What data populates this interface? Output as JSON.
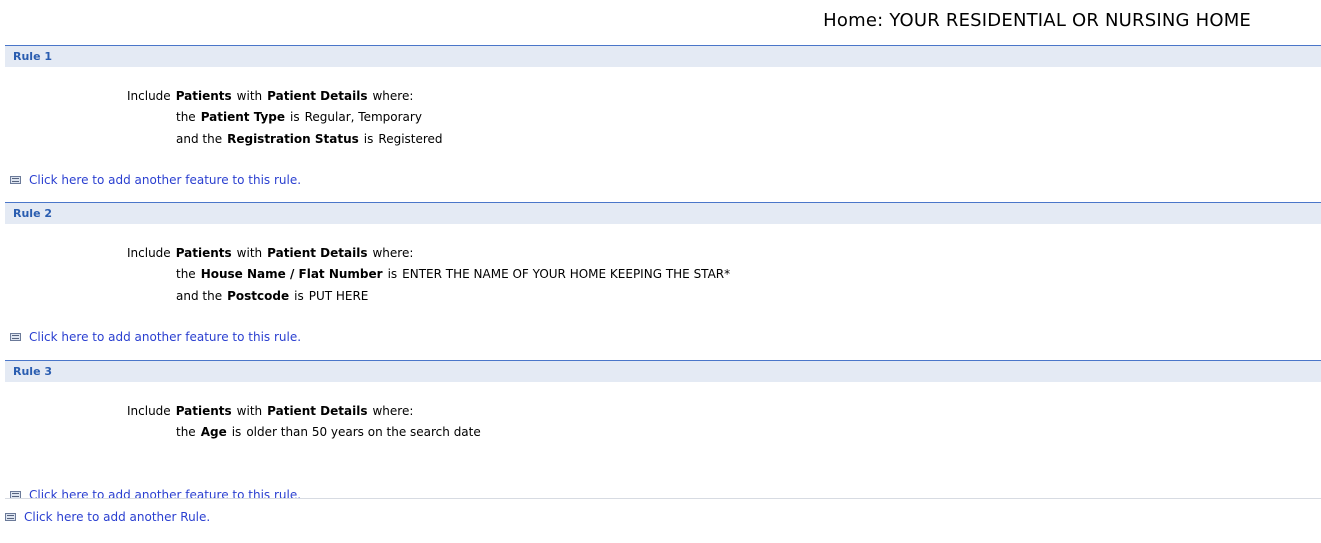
{
  "page": {
    "title": "Home: YOUR RESIDENTIAL OR NURSING HOME"
  },
  "rules": [
    {
      "title": "Rule 1",
      "include": "Include",
      "entity": "Patients",
      "with": "with",
      "details": "Patient Details",
      "where": "where:",
      "conditions": [
        {
          "prefix": "the",
          "field": "Patient Type",
          "op": "is",
          "value": "Regular, Temporary"
        },
        {
          "prefix": "and the",
          "field": "Registration Status",
          "op": "is",
          "value": "Registered"
        }
      ],
      "add_feature_label": "Click here to add another feature to this rule."
    },
    {
      "title": "Rule 2",
      "include": "Include",
      "entity": "Patients",
      "with": "with",
      "details": "Patient Details",
      "where": "where:",
      "conditions": [
        {
          "prefix": "the",
          "field": "House Name / Flat Number",
          "op": "is",
          "value": "ENTER THE NAME OF YOUR HOME KEEPING THE STAR*"
        },
        {
          "prefix": "and the",
          "field": "Postcode",
          "op": "is",
          "value": "PUT HERE"
        }
      ],
      "add_feature_label": "Click here to add another feature to this rule."
    },
    {
      "title": "Rule 3",
      "include": "Include",
      "entity": "Patients",
      "with": "with",
      "details": "Patient Details",
      "where": "where:",
      "conditions": [
        {
          "prefix": "the",
          "field": "Age",
          "op": "is",
          "value": "older than 50 years on the search date"
        }
      ],
      "add_feature_label": "Click here to add another feature to this rule."
    }
  ],
  "add_rule_label": "Click here to add another Rule.",
  "icons": {
    "add": "list-icon"
  },
  "colors": {
    "rule_header_bg": "#e4eaf4",
    "rule_header_border": "#4a76c9",
    "rule_title": "#2a5db0",
    "link": "#2a3fd0"
  }
}
